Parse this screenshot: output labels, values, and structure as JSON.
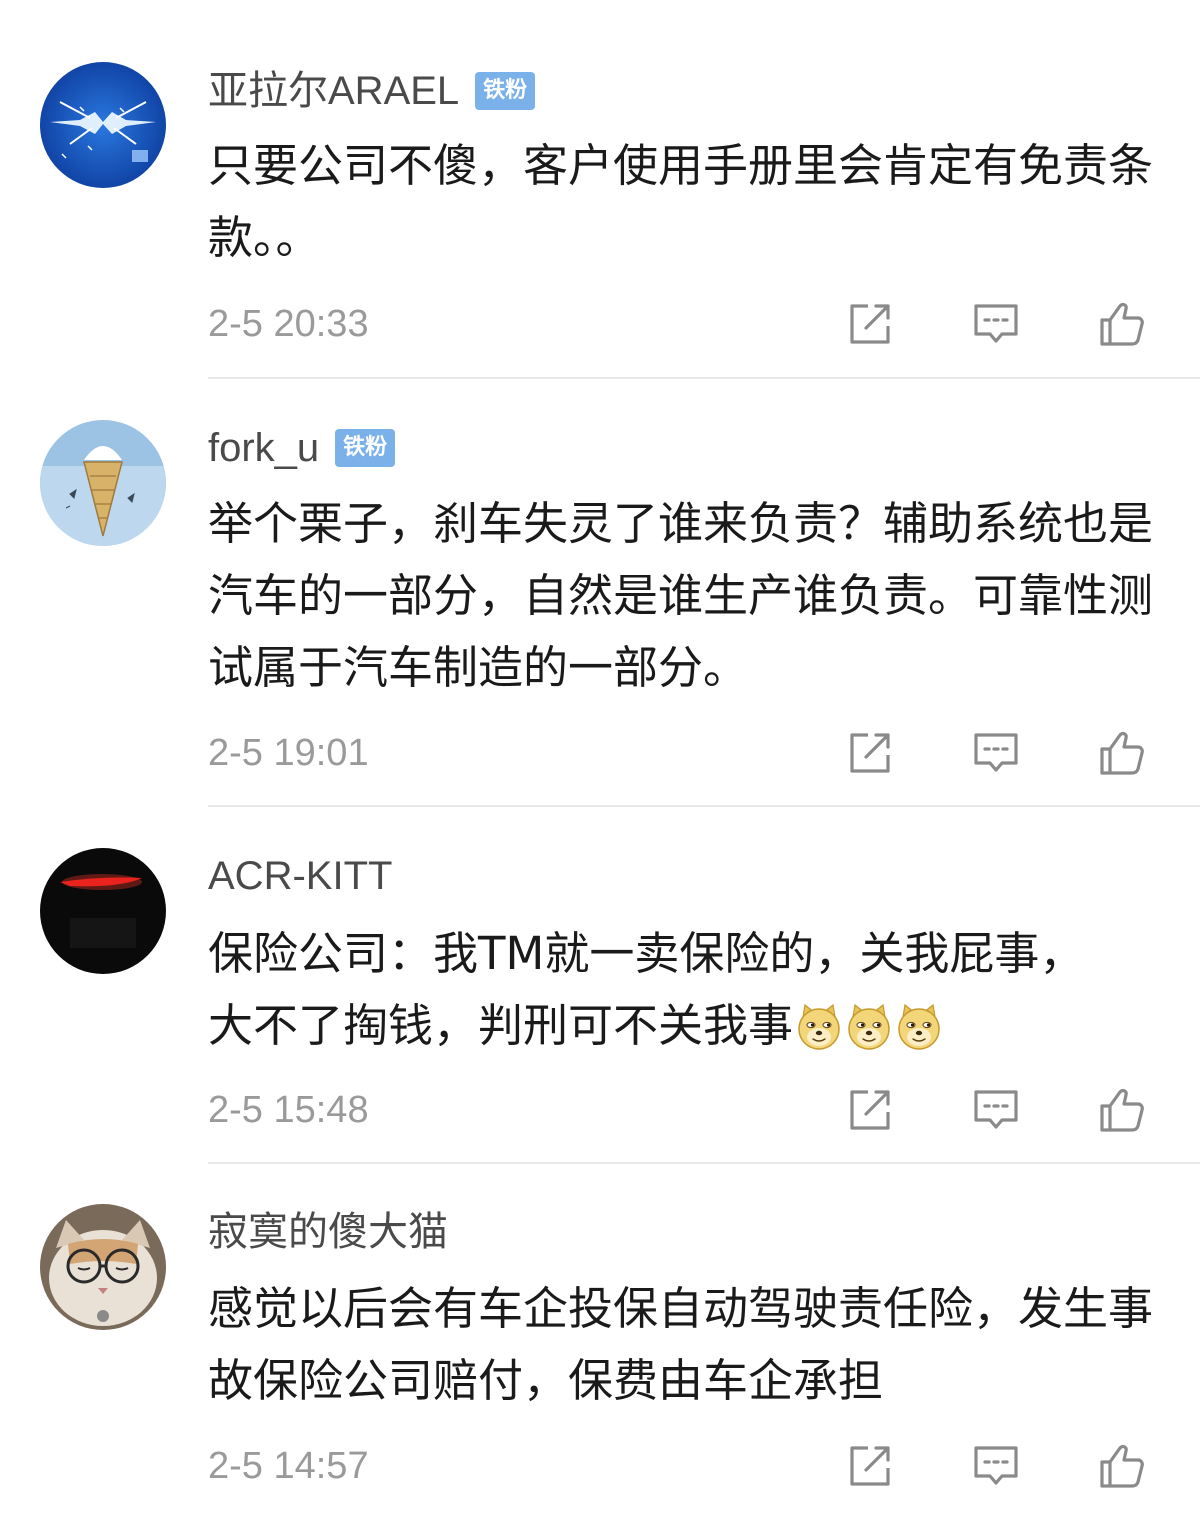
{
  "comments": [
    {
      "username": "亚拉尔ARAEL",
      "badge": "铁粉",
      "text": "只要公司不傻，客户使用手册里会肯定有免责条款。。",
      "timestamp": "2-5 20:33",
      "avatar": "blue-lightning-avatar"
    },
    {
      "username": "fork_u",
      "badge": "铁粉",
      "text": "举个栗子，刹车失灵了谁来负责？辅助系统也是汽车的一部分，自然是谁生产谁负责。可靠性测试属于汽车制造的一部分。",
      "timestamp": "2-5 19:01",
      "avatar": "ice-cream-cone-avatar"
    },
    {
      "username": "ACR-KITT",
      "badge": "",
      "text": "保险公司：我TM就一卖保险的，关我屁事，大不了掏钱，判刑可不关我事",
      "emojis": [
        "doge-emoji",
        "doge-emoji",
        "doge-emoji"
      ],
      "timestamp": "2-5 15:48",
      "avatar": "red-light-avatar"
    },
    {
      "username": "寂寞的傻大猫",
      "badge": "",
      "text": "感觉以后会有车企投保自动驾驶责任险，发生事故保险公司赔付，保费由车企承担",
      "timestamp": "2-5 14:57",
      "avatar": "cat-with-glasses-avatar"
    }
  ],
  "icons": {
    "share": "share-icon",
    "reply": "reply-icon",
    "like": "thumbs-up-icon"
  },
  "colors": {
    "badge": "#7ab1e8",
    "username": "#4a4a4a",
    "timestamp": "#9a9a9a",
    "text": "#1a1a1a",
    "icon": "#8a8a8a"
  }
}
